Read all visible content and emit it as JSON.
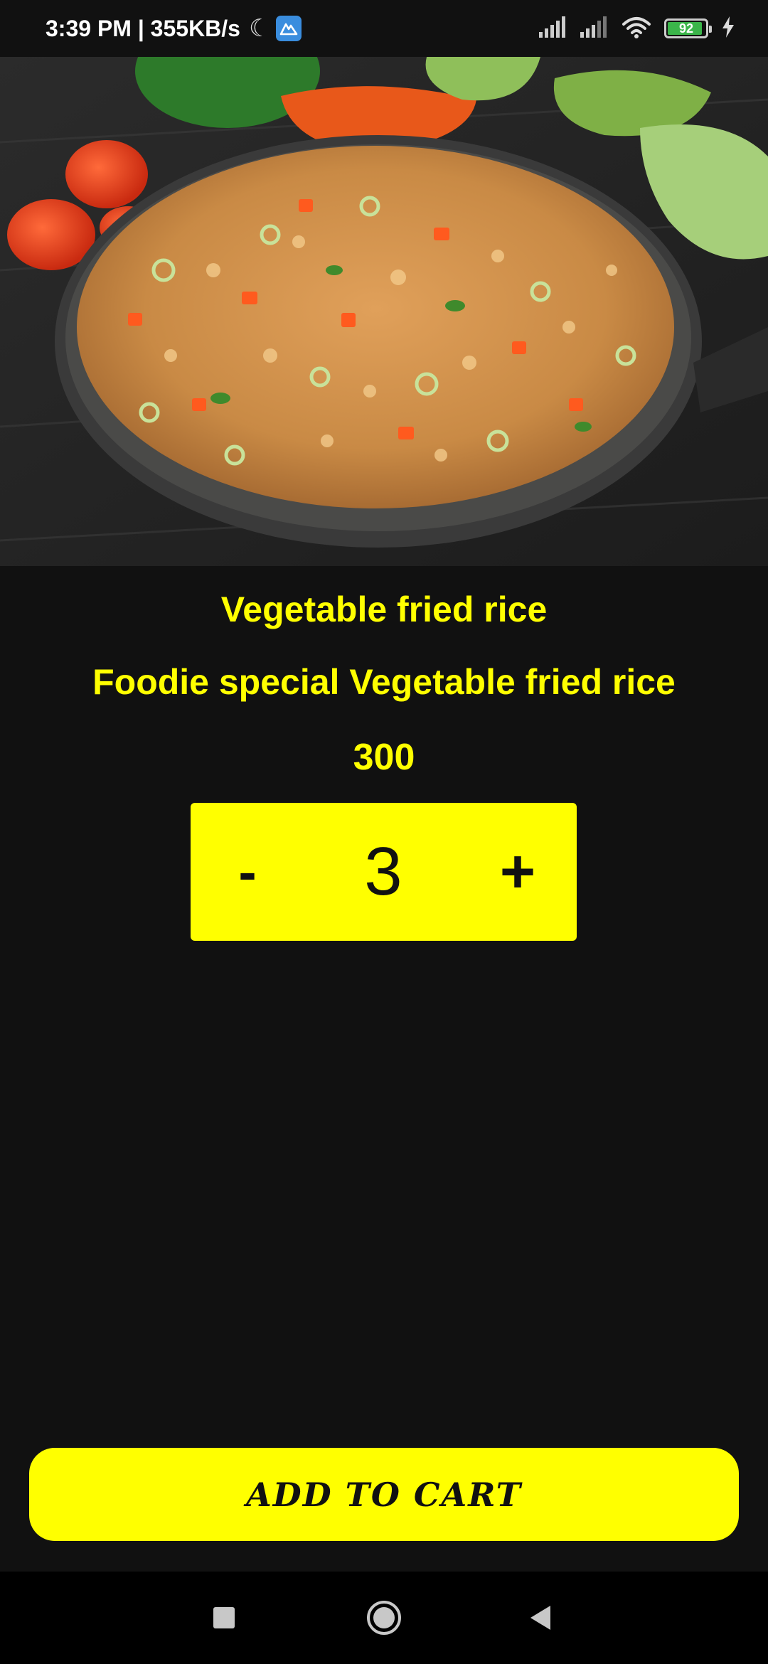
{
  "status_bar": {
    "time_speed": "3:39 PM | 355KB/s",
    "battery_level": "92",
    "battery_fraction": 0.92,
    "icons": [
      "moon-icon",
      "app-badge-icon",
      "signal-icon",
      "signal-icon",
      "wifi-icon",
      "battery-icon",
      "charging-icon"
    ]
  },
  "product": {
    "name": "Vegetable fried rice",
    "description": "Foodie special Vegetable fried rice",
    "price": "300"
  },
  "stepper": {
    "minus_label": "-",
    "quantity": "3",
    "plus_label": "+"
  },
  "cart": {
    "button_label": "ADD TO CART"
  },
  "nav": {
    "icons": [
      "recents-icon",
      "home-icon",
      "back-icon"
    ]
  },
  "colors": {
    "background": "#111111",
    "accent": "#ffff00",
    "accent_text": "#111111",
    "nav_background": "#000000"
  }
}
